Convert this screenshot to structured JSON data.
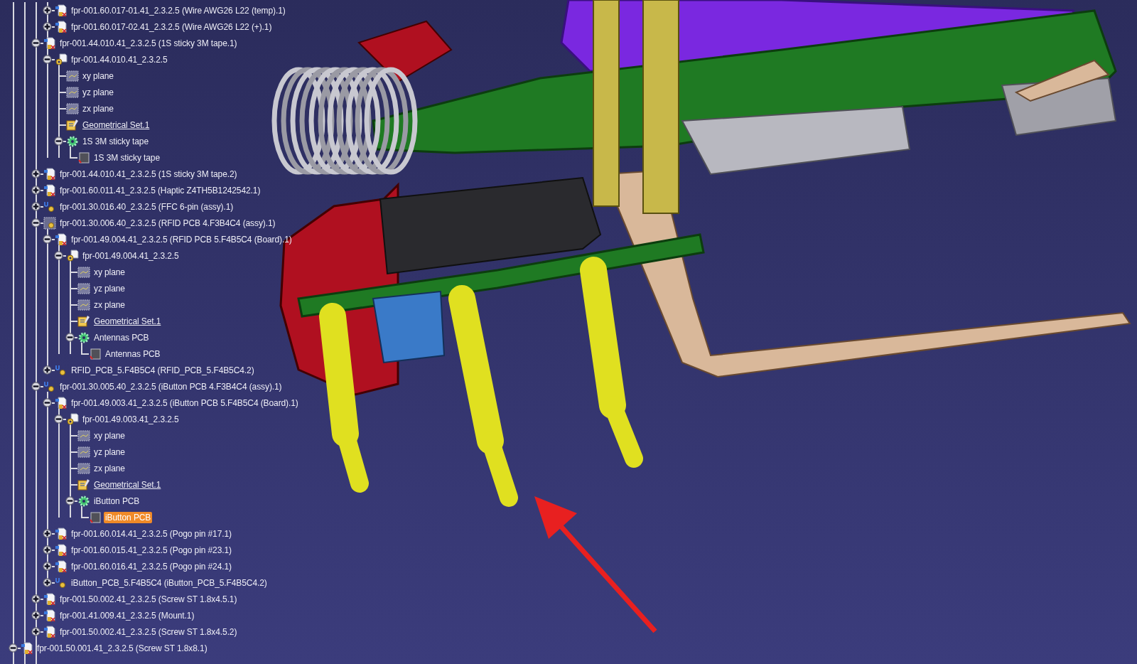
{
  "tree": [
    {
      "children": [
        {
          "children": [
            {
              "children": [
                {
                  "children": [
                    {
                      "label": "fpr-001.60.017-01.41_2.3.2.5 (Wire AWG26 L22 (temp).1)",
                      "kind": "part-instance",
                      "expanded": false,
                      "selected": false
                    },
                    {
                      "label": "fpr-001.60.017-02.41_2.3.2.5 (Wire AWG26 L22 (+).1)",
                      "kind": "part-instance",
                      "expanded": false,
                      "selected": false
                    }
                  ]
                },
                {
                  "label": "fpr-001.44.010.41_2.3.2.5 (1S sticky 3M tape.1)",
                  "kind": "part-instance",
                  "expanded": true,
                  "selected": false,
                  "children": [
                    {
                      "label": "fpr-001.44.010.41_2.3.2.5",
                      "kind": "part",
                      "expanded": true,
                      "selected": false,
                      "children": [
                        {
                          "label": "xy plane",
                          "kind": "plane",
                          "selected": false
                        },
                        {
                          "label": "yz plane",
                          "kind": "plane",
                          "selected": false
                        },
                        {
                          "label": "zx plane",
                          "kind": "plane",
                          "selected": false
                        },
                        {
                          "label": "Geometrical Set.1",
                          "kind": "geoset",
                          "selected": false
                        },
                        {
                          "label": "1S 3M sticky tape",
                          "kind": "body",
                          "expanded": true,
                          "selected": false,
                          "children": [
                            {
                              "label": "1S 3M sticky tape",
                              "kind": "feature",
                              "selected": false
                            }
                          ]
                        }
                      ]
                    }
                  ]
                },
                {
                  "label": "fpr-001.44.010.41_2.3.2.5 (1S sticky 3M tape.2)",
                  "kind": "part-instance",
                  "expanded": false,
                  "selected": false
                },
                {
                  "label": "fpr-001.60.011.41_2.3.2.5 (Haptic Z4TH5B1242542.1)",
                  "kind": "part-instance",
                  "expanded": false,
                  "selected": false
                },
                {
                  "label": "fpr-001.30.016.40_2.3.2.5 (FFC 6-pin (assy).1)",
                  "kind": "assembly",
                  "expanded": false,
                  "selected": false
                },
                {
                  "label": "fpr-001.30.006.40_2.3.2.5 (RFID PCB 4.F3B4C4 (assy).1)",
                  "kind": "assembly-grid",
                  "expanded": true,
                  "selected": false,
                  "children": [
                    {
                      "label": "fpr-001.49.004.41_2.3.2.5 (RFID PCB 5.F4B5C4 (Board).1)",
                      "kind": "part-instance",
                      "expanded": true,
                      "selected": false,
                      "children": [
                        {
                          "label": "fpr-001.49.004.41_2.3.2.5",
                          "kind": "part",
                          "expanded": true,
                          "selected": false,
                          "children": [
                            {
                              "label": "xy plane",
                              "kind": "plane",
                              "selected": false
                            },
                            {
                              "label": "yz plane",
                              "kind": "plane",
                              "selected": false
                            },
                            {
                              "label": "zx plane",
                              "kind": "plane",
                              "selected": false
                            },
                            {
                              "label": "Geometrical Set.1",
                              "kind": "geoset",
                              "selected": false
                            },
                            {
                              "label": "Antennas PCB",
                              "kind": "body",
                              "expanded": true,
                              "selected": false,
                              "children": [
                                {
                                  "label": "Antennas PCB",
                                  "kind": "feature",
                                  "selected": false
                                }
                              ]
                            }
                          ]
                        }
                      ]
                    },
                    {
                      "label": "RFID_PCB_5.F4B5C4 (RFID_PCB_5.F4B5C4.2)",
                      "kind": "assembly",
                      "expanded": false,
                      "selected": false
                    }
                  ]
                },
                {
                  "label": "fpr-001.30.005.40_2.3.2.5 (iButton PCB 4.F3B4C4 (assy).1)",
                  "kind": "assembly",
                  "expanded": true,
                  "selected": false,
                  "children": [
                    {
                      "label": "fpr-001.49.003.41_2.3.2.5 (iButton PCB 5.F4B5C4 (Board).1)",
                      "kind": "part-instance",
                      "expanded": true,
                      "selected": false,
                      "children": [
                        {
                          "label": "fpr-001.49.003.41_2.3.2.5",
                          "kind": "part",
                          "expanded": true,
                          "selected": false,
                          "children": [
                            {
                              "label": "xy plane",
                              "kind": "plane",
                              "selected": false
                            },
                            {
                              "label": "yz plane",
                              "kind": "plane",
                              "selected": false
                            },
                            {
                              "label": "zx plane",
                              "kind": "plane",
                              "selected": false
                            },
                            {
                              "label": "Geometrical Set.1",
                              "kind": "geoset",
                              "selected": false
                            },
                            {
                              "label": "iButton PCB",
                              "kind": "body",
                              "expanded": true,
                              "selected": false,
                              "children": [
                                {
                                  "label": "iButton PCB",
                                  "kind": "feature",
                                  "selected": true
                                }
                              ]
                            }
                          ]
                        }
                      ]
                    },
                    {
                      "label": "fpr-001.60.014.41_2.3.2.5 (Pogo pin #17.1)",
                      "kind": "part-instance",
                      "expanded": false,
                      "selected": false
                    },
                    {
                      "label": "fpr-001.60.015.41_2.3.2.5 (Pogo pin #23.1)",
                      "kind": "part-instance",
                      "expanded": false,
                      "selected": false
                    },
                    {
                      "label": "fpr-001.60.016.41_2.3.2.5 (Pogo pin #24.1)",
                      "kind": "part-instance",
                      "expanded": false,
                      "selected": false
                    },
                    {
                      "label": "iButton_PCB_5.F4B5C4 (iButton_PCB_5.F4B5C4.2)",
                      "kind": "assembly",
                      "expanded": false,
                      "selected": false
                    }
                  ]
                },
                {
                  "label": "fpr-001.50.002.41_2.3.2.5 (Screw ST 1.8x4.5.1)",
                  "kind": "part-instance",
                  "expanded": false,
                  "selected": false
                },
                {
                  "label": "fpr-001.41.009.41_2.3.2.5 (Mount.1)",
                  "kind": "part-instance",
                  "expanded": false,
                  "selected": false
                },
                {
                  "label": "fpr-001.50.002.41_2.3.2.5 (Screw ST 1.8x4.5.2)",
                  "kind": "part-instance",
                  "expanded": false,
                  "selected": false
                }
              ]
            }
          ]
        },
        {
          "label": "fpr-001.50.001.41_2.3.2.5 (Screw ST 1.8x8.1)",
          "kind": "part-instance",
          "expanded": true,
          "selected": false
        }
      ]
    }
  ]
}
